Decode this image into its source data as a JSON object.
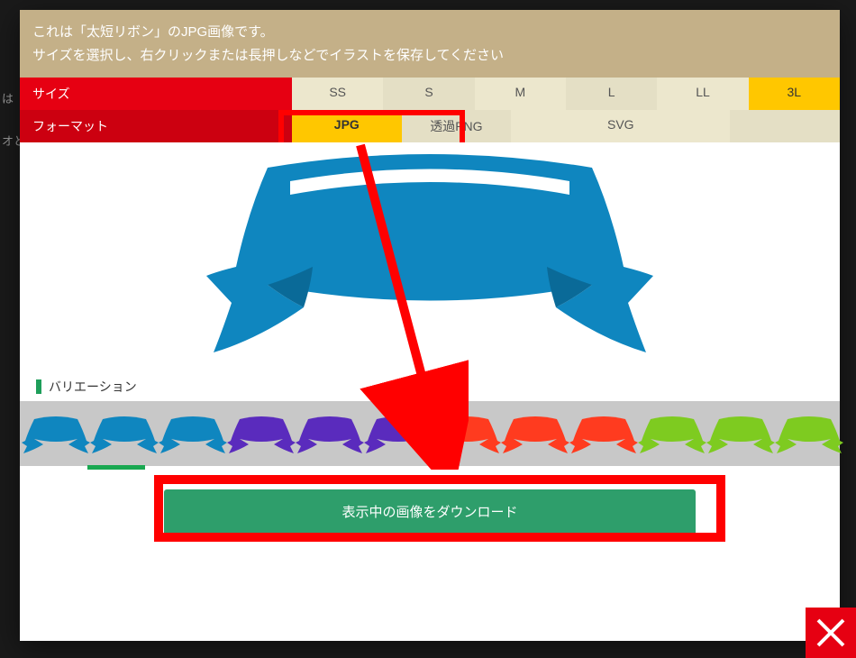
{
  "header": {
    "line1": "これは「太短リボン」のJPG画像です。",
    "line2": "サイズを選択し、右クリックまたは長押しなどでイラストを保存してください"
  },
  "size_row": {
    "label": "サイズ",
    "options": [
      "SS",
      "S",
      "M",
      "L",
      "LL",
      "3L"
    ],
    "active": "3L"
  },
  "format_row": {
    "label": "フォーマット",
    "options": [
      "JPG",
      "透過PNG",
      "SVG"
    ],
    "active": "JPG"
  },
  "preview": {
    "color": "#0f86bf"
  },
  "variation": {
    "title": "バリエーション",
    "colors": [
      "#0f86bf",
      "#0f86bf",
      "#0f86bf",
      "#5a2bbd",
      "#5a2bbd",
      "#5a2bbd",
      "#ff3b1f",
      "#ff3b1f",
      "#ff3b1f",
      "#7ecb20",
      "#7ecb20",
      "#7ecb20"
    ],
    "selected_index": 1
  },
  "download": {
    "label": "表示中の画像をダウンロード"
  },
  "close": {
    "name": "close"
  },
  "bg": {
    "t1": "は",
    "t2": "オと"
  }
}
